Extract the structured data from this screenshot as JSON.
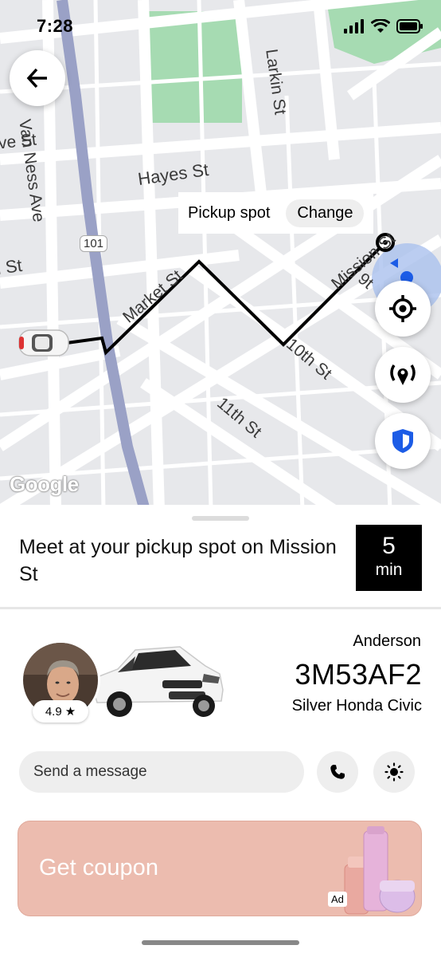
{
  "status_bar": {
    "time": "7:28"
  },
  "map": {
    "street_labels": [
      "ve St",
      "Van Ness Ave",
      "Larkin St",
      "Hayes St",
      "101",
      "l St",
      "Market St",
      "Mission St",
      "9t",
      "10th St",
      "11th St"
    ],
    "attribution": "Google",
    "pickup_callout": {
      "label": "Pickup spot",
      "change_label": "Change"
    }
  },
  "sheet": {
    "meet_text": "Meet at your pickup spot on Mission St",
    "eta": {
      "value": "5",
      "unit": "min"
    },
    "driver": {
      "name": "Anderson",
      "rating": "4.9",
      "plate": "3M53AF2",
      "car": "Silver Honda Civic"
    },
    "message_placeholder": "Send a message",
    "coupon": {
      "label": "Get coupon",
      "ad_badge": "Ad"
    }
  },
  "colors": {
    "accent_blue": "#1c5ce6",
    "coupon_bg": "#ecbcaf",
    "eta_bg": "#000000"
  }
}
